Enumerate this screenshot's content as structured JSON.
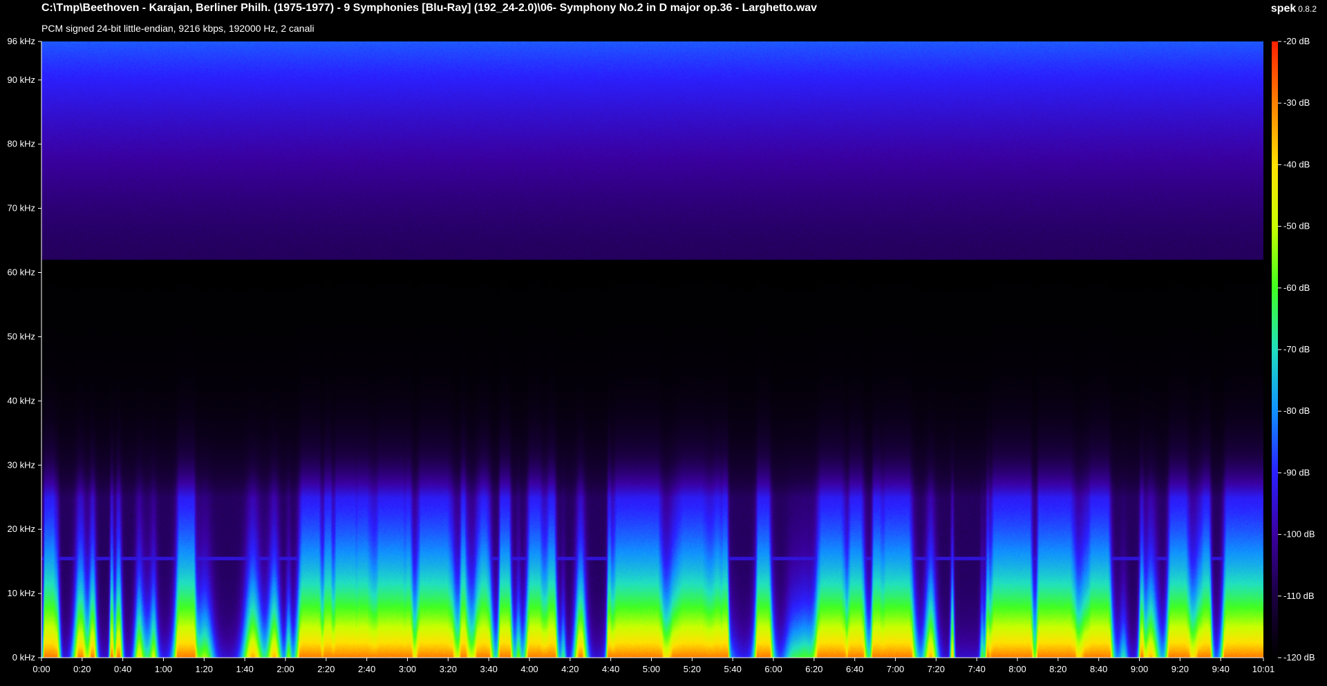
{
  "window": {
    "title": "C:\\Tmp\\Beethoven - Karajan, Berliner Philh. (1975-1977) - 9 Symphonies [Blu-Ray] (192_24-2.0)\\06- Symphony No.2 in D major op.36 - Larghetto.wav",
    "subtitle": "PCM signed 24-bit little-endian, 9216 kbps, 192000 Hz, 2 canali",
    "app_name": "spek",
    "app_version": "0.8.2"
  },
  "chart_data": {
    "type": "heatmap",
    "title": "",
    "y_ticks": [
      "96 kHz",
      "90 kHz",
      "80 kHz",
      "70 kHz",
      "60 kHz",
      "50 kHz",
      "40 kHz",
      "30 kHz",
      "20 kHz",
      "10 kHz",
      "0 kHz"
    ],
    "y_values_khz": [
      96,
      90,
      80,
      70,
      60,
      50,
      40,
      30,
      20,
      10,
      0
    ],
    "x_ticks": [
      "0:00",
      "0:20",
      "0:40",
      "1:00",
      "1:20",
      "1:40",
      "2:00",
      "2:20",
      "2:40",
      "3:00",
      "3:20",
      "3:40",
      "4:00",
      "4:20",
      "4:40",
      "5:00",
      "5:20",
      "5:40",
      "6:00",
      "6:20",
      "6:40",
      "7:00",
      "7:20",
      "7:40",
      "8:00",
      "8:20",
      "8:40",
      "9:00",
      "9:20",
      "9:40",
      "10:01"
    ],
    "x_values_s": [
      0,
      20,
      40,
      60,
      80,
      100,
      120,
      140,
      160,
      180,
      200,
      220,
      240,
      260,
      280,
      300,
      320,
      340,
      360,
      380,
      400,
      420,
      440,
      460,
      480,
      500,
      520,
      540,
      560,
      580,
      601
    ],
    "x_range_s": [
      0,
      601
    ],
    "y_range_khz": [
      0,
      96
    ],
    "colorbar": {
      "labels": [
        "-20 dB",
        "-30 dB",
        "-40 dB",
        "-50 dB",
        "-60 dB",
        "-70 dB",
        "-80 dB",
        "-90 dB",
        "-100 dB",
        "-110 dB",
        "-120 dB"
      ],
      "values_db": [
        -20,
        -30,
        -40,
        -50,
        -60,
        -70,
        -80,
        -90,
        -100,
        -110,
        -120
      ],
      "range_db": [
        -120,
        -20
      ],
      "colors": [
        "#000000",
        "#1a0040",
        "#3a00a0",
        "#2a20ff",
        "#1090ff",
        "#20e0c0",
        "#40ff20",
        "#c8ff00",
        "#ffe000",
        "#ff8000",
        "#ff2000"
      ]
    }
  }
}
